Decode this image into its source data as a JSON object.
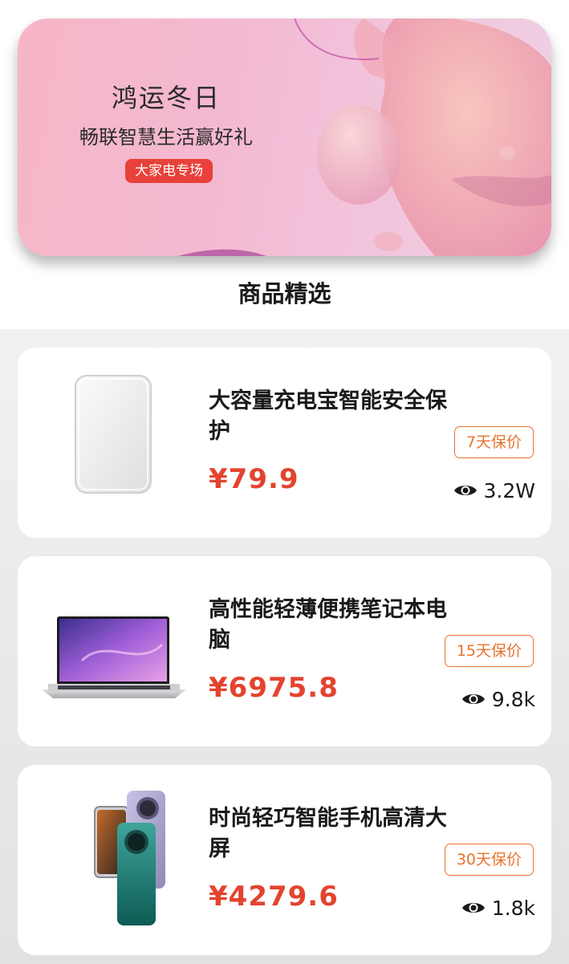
{
  "banner": {
    "title": "鸿运冬日",
    "subtitle": "畅联智慧生活赢好礼",
    "tag": "大家电专场"
  },
  "section": {
    "title": "商品精选"
  },
  "products": [
    {
      "name": "大容量充电宝智能安全保护",
      "price": "¥79.9",
      "warranty": "7天保价",
      "views": "3.2W",
      "image_icon": "power-bank-icon"
    },
    {
      "name": "高性能轻薄便携笔记本电脑",
      "price": "¥6975.8",
      "warranty": "15天保价",
      "views": "9.8k",
      "image_icon": "laptop-icon"
    },
    {
      "name": "时尚轻巧智能手机高清大屏",
      "price": "¥4279.6",
      "warranty": "30天保价",
      "views": "1.8k",
      "image_icon": "smartphone-icon"
    }
  ],
  "colors": {
    "price": "#e3442f",
    "warranty": "#e8722f",
    "banner_tag": "#e8413a"
  }
}
